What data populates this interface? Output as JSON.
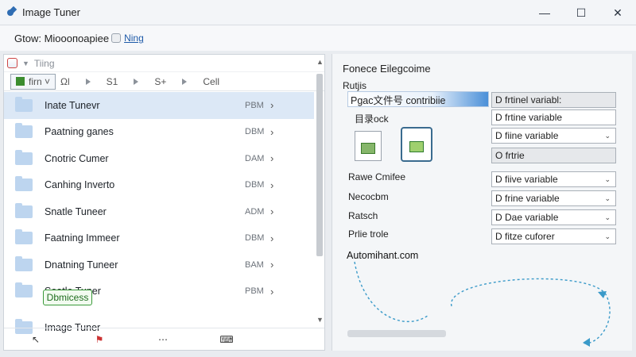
{
  "window": {
    "title": "Image Tuner",
    "controls": [
      "—",
      "☐",
      "✕"
    ]
  },
  "addressbar": {
    "text": "Gtow: Mioooпоаріее",
    "link": "Ning"
  },
  "left": {
    "header_label": "Tiing",
    "tabs": [
      {
        "label": "firn ˅",
        "active": true
      },
      {
        "label": "Ωl"
      },
      {
        "label": "S1"
      },
      {
        "label": "S+"
      },
      {
        "label": "Cell"
      }
    ],
    "rows": [
      {
        "label": "Inate Tunevr",
        "size": "PBM",
        "selected": true
      },
      {
        "label": "Paatning ganes",
        "size": "DBM"
      },
      {
        "label": "Cnotric Cumer",
        "size": "DAM"
      },
      {
        "label": "Canhing Inverto",
        "size": "DBM"
      },
      {
        "label": "Snatle Tuneer",
        "size": "ADM"
      },
      {
        "label": "Faatning Immeer",
        "size": "DBM"
      },
      {
        "label": "Dnatning Tuneer",
        "size": "BAM"
      },
      {
        "label": "Soatle Tuner",
        "size": "PBM"
      },
      {
        "label": "Image Tuner",
        "size": ""
      }
    ],
    "status_chip": "Dbmicess",
    "bottom_icons": [
      "pointer-icon",
      "flag-icon",
      "dots-icon",
      "keyboard-icon"
    ]
  },
  "right": {
    "heading": "Fonece Eilegcoime",
    "subheading": "Rutjis",
    "field_value": "Pgac文件号 contribiie",
    "thumb_label": "目录ock",
    "values": [
      {
        "text": "D frtinel variabl:",
        "dropdown": false,
        "gray": true
      },
      {
        "text": "D frtine variable",
        "dropdown": false,
        "gray": false
      },
      {
        "text": "D fiine variable",
        "dropdown": true,
        "gray": false
      },
      {
        "text": "O frtrie",
        "dropdown": false,
        "gray": true
      },
      {
        "text": "D fiive variable",
        "dropdown": true,
        "gray": false
      },
      {
        "text": "D frine variable",
        "dropdown": true,
        "gray": false
      },
      {
        "text": "D Dae variable",
        "dropdown": true,
        "gray": false
      },
      {
        "text": "D fitze cuforer",
        "dropdown": true,
        "gray": false
      }
    ],
    "labels": [
      "Rawe Cmifee",
      "Necocbm",
      "Ratsch",
      "Prlie trole"
    ],
    "url": "Automihant.com",
    "accent": "#4a8fd8"
  }
}
